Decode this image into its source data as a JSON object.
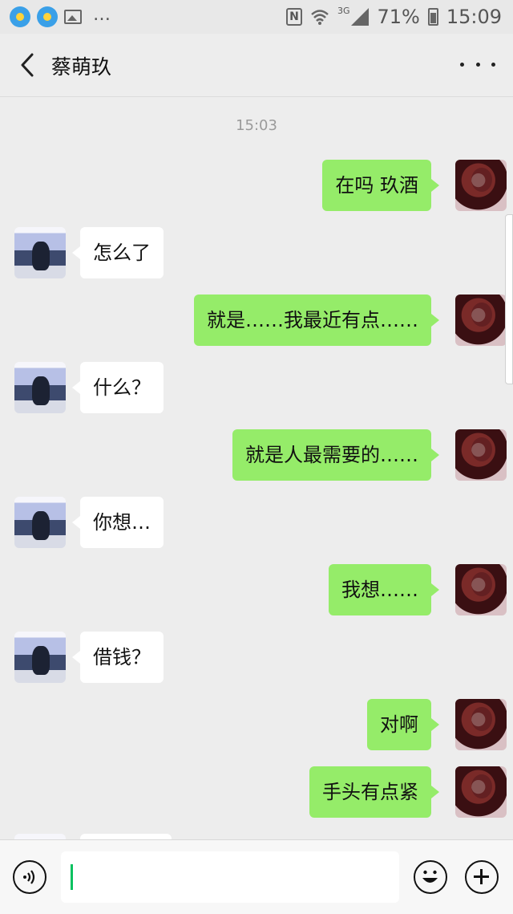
{
  "status_bar": {
    "battery_percent": "71%",
    "time": "15:09",
    "network": "3G",
    "overflow": "…"
  },
  "header": {
    "title": "蔡萌玖"
  },
  "chat": {
    "timestamp": "15:03",
    "messages": [
      {
        "side": "right",
        "text": "在吗 玖酒"
      },
      {
        "side": "left",
        "text": "怎么了"
      },
      {
        "side": "right",
        "text": "就是……我最近有点……"
      },
      {
        "side": "left",
        "text": "什么？"
      },
      {
        "side": "right",
        "text": "就是人最需要的……"
      },
      {
        "side": "left",
        "text": "你想…"
      },
      {
        "side": "right",
        "text": "我想……"
      },
      {
        "side": "left",
        "text": "借钱？"
      },
      {
        "side": "right",
        "text": "对啊"
      },
      {
        "side": "right",
        "text": "手头有点紧"
      }
    ]
  },
  "input": {
    "value": ""
  },
  "colors": {
    "sent_bubble": "#95ec69",
    "received_bubble": "#ffffff",
    "background": "#ededed"
  }
}
